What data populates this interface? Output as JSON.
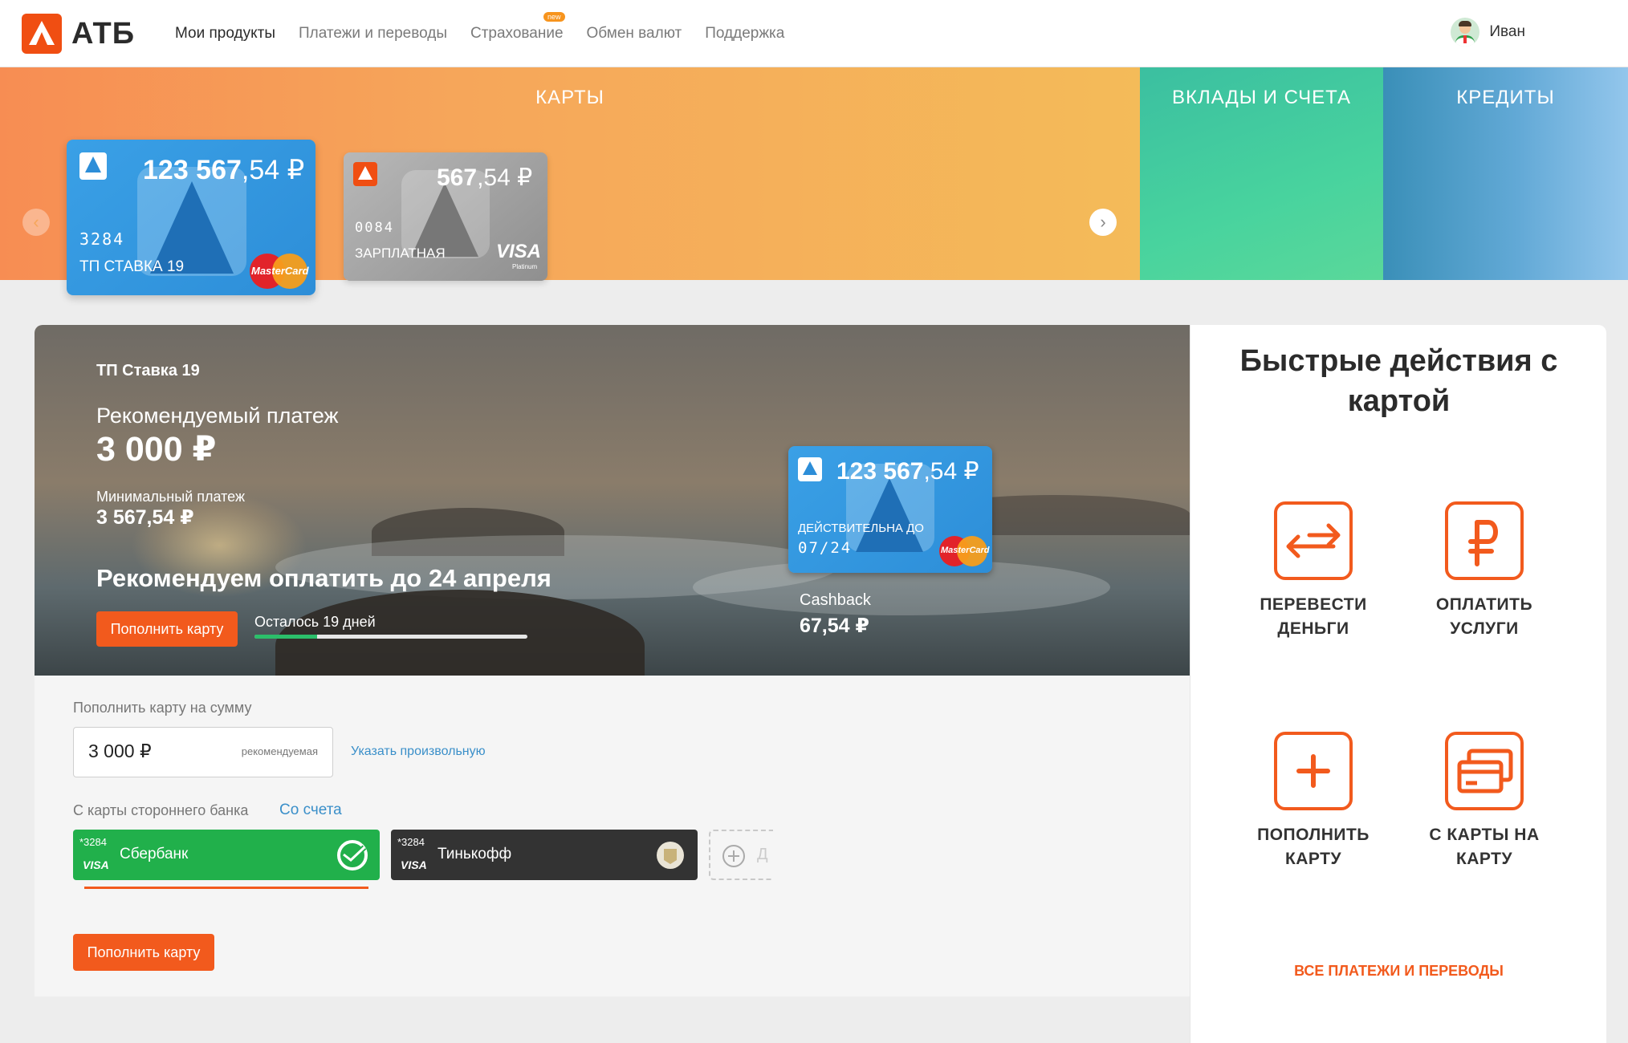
{
  "header": {
    "logo_text": "АТБ",
    "nav": [
      {
        "label": "Мои продукты",
        "active": true
      },
      {
        "label": "Платежи и переводы"
      },
      {
        "label": "Страхование",
        "badge": "new"
      },
      {
        "label": "Обмен валют"
      },
      {
        "label": "Поддержка"
      }
    ],
    "user_name": "Иван"
  },
  "banner": {
    "cards_title": "КАРТЫ",
    "deposits_title": "ВКЛАДЫ И СЧЕТА",
    "credits_title": "КРЕДИТЫ",
    "cards": [
      {
        "balance_int": "123 567",
        "balance_frac": ",54 ₽",
        "last4": "3284",
        "name": "ТП СТАВКА 19",
        "brand": "MasterCard"
      },
      {
        "balance_int": "567",
        "balance_frac": ",54 ₽",
        "last4": "0084",
        "name": "ЗАРПЛАТНАЯ",
        "brand": "VISA",
        "brand_sub": "Platinum"
      }
    ]
  },
  "detail": {
    "card_title": "ТП Ставка 19",
    "recommended_label": "Рекомендуемый платеж",
    "recommended_amount": "3 000 ₽",
    "min_label": "Минимальный платеж",
    "min_amount": "3 567,54 ₽",
    "deadline": "Рекомендуем оплатить до 24 апреля",
    "topup_button": "Пополнить карту",
    "days_left": "Осталось 19 дней",
    "progress": 0.23,
    "card": {
      "balance_int": "123 567",
      "balance_frac": ",54 ₽",
      "valid_label": "ДЕЙСТВИТЕЛЬНА ДО",
      "valid_date": "07/24",
      "brand": "MasterCard"
    },
    "cashback_label": "Cashback",
    "cashback_amount": "67,54 ₽"
  },
  "topup": {
    "amount_label": "Пополнить карту на сумму",
    "amount_value": "3 000 ₽",
    "amount_hint": "рекомендуемая",
    "custom_link": "Указать произвольную",
    "source_tab_other": "С карты стороннего банка",
    "source_tab_account": "Со счета",
    "banks": [
      {
        "num": "*3284",
        "brand": "VISA",
        "name": "Сбербанк",
        "color": "#21b04b"
      },
      {
        "num": "*3284",
        "brand": "VISA",
        "name": "Тинькофф",
        "color": "#333333"
      }
    ],
    "add_label": "Д",
    "submit_button": "Пополнить карту"
  },
  "quick": {
    "title": "Быстрые действия с картой",
    "actions": [
      {
        "icon": "transfer-arrows-icon",
        "line1": "ПЕРЕВЕСТИ",
        "line2": "ДЕНЬГИ"
      },
      {
        "icon": "ruble-icon",
        "line1": "ОПЛАТИТЬ",
        "line2": "УСЛУГИ"
      },
      {
        "icon": "plus-icon",
        "line1": "ПОПОЛНИТЬ",
        "line2": "КАРТУ"
      },
      {
        "icon": "cards-icon",
        "line1": "С КАРТЫ НА",
        "line2": "КАРТУ"
      }
    ],
    "all_link": "ВСЕ ПЛАТЕЖИ И ПЕРЕВОДЫ"
  },
  "colors": {
    "accent": "#f25a1d",
    "brand_blue": "#2d8ed8",
    "progress": "#2bbf6a"
  }
}
